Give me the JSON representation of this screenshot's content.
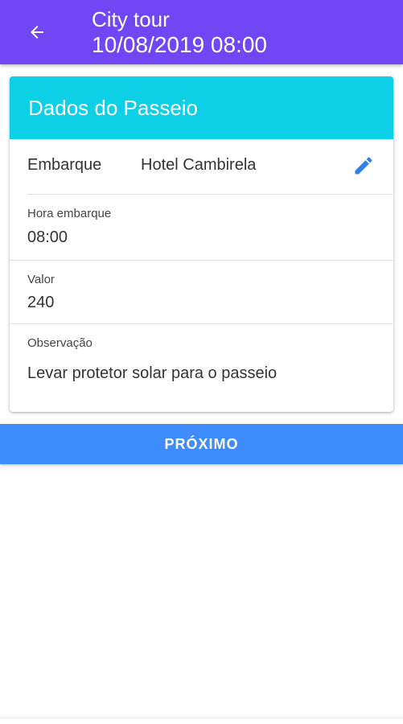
{
  "appbar": {
    "back_icon": "arrow-left-icon",
    "title": "City tour",
    "subtitle": "10/08/2019 08:00",
    "color": "#7047f4"
  },
  "card": {
    "header": "Dados do Passeio",
    "header_color": "#0dcfe6",
    "embarque": {
      "label": "Embarque",
      "value": "Hotel Cambirela",
      "edit_icon": "pencil-icon"
    },
    "hora_embarque": {
      "label": "Hora embarque",
      "value": "08:00"
    },
    "valor": {
      "label": "Valor",
      "value": "240"
    },
    "observacao": {
      "label": "Observação",
      "value": "Levar protetor solar para o passeio"
    }
  },
  "next_button": {
    "label": "PRÓXIMO",
    "color": "#3d8bfd"
  }
}
